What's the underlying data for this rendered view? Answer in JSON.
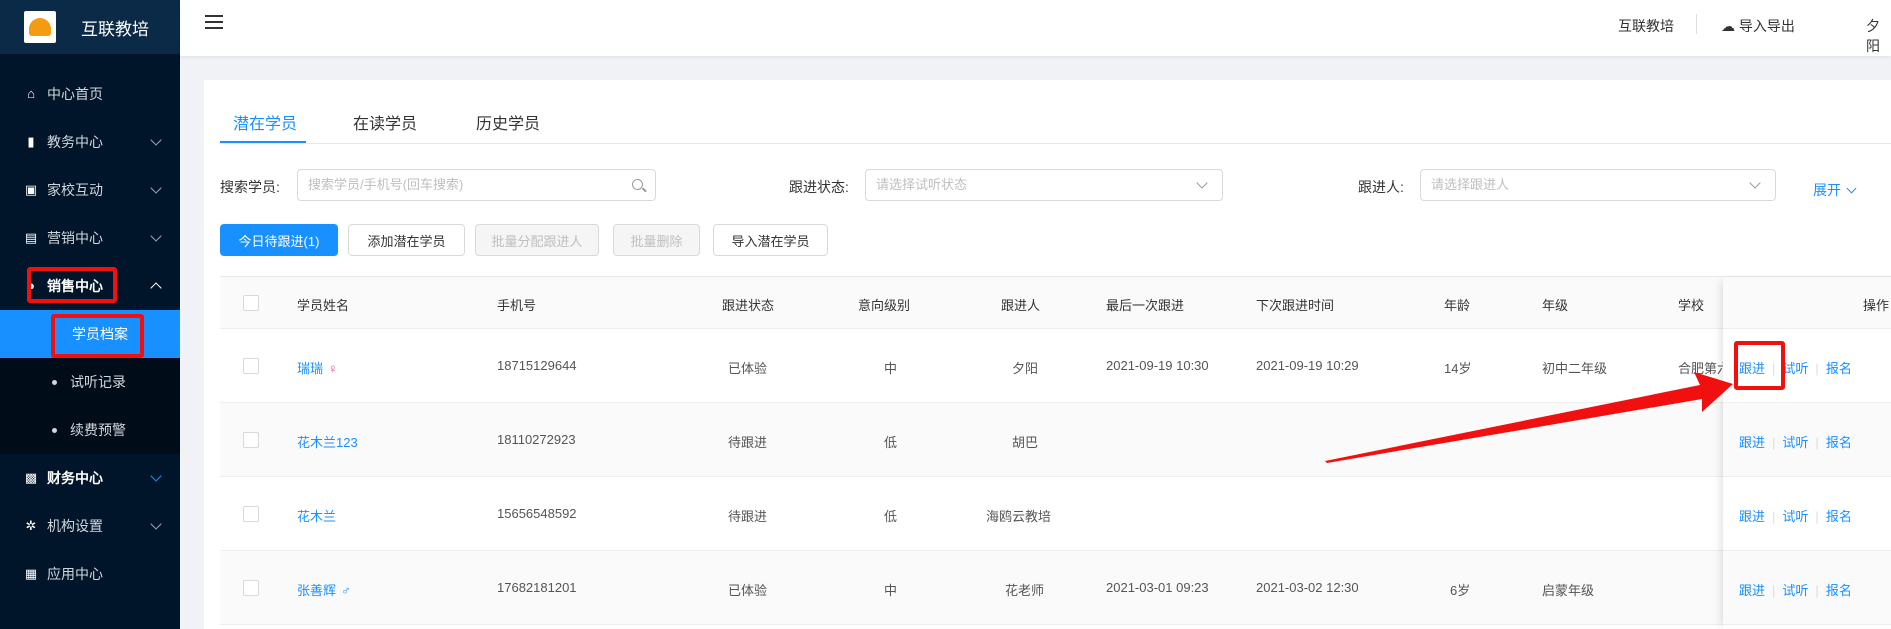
{
  "app": {
    "title": "互联教培",
    "colors": {
      "sidebar": "#001529",
      "accent": "#1890ff",
      "highlight": "#f01010"
    }
  },
  "sidebar": {
    "items": [
      {
        "label": "中心首页",
        "icon": "home-icon"
      },
      {
        "label": "教务中心",
        "icon": "book-icon"
      },
      {
        "label": "家校互动",
        "icon": "chat-icon"
      },
      {
        "label": "营销中心",
        "icon": "gift-icon"
      },
      {
        "label": "销售中心",
        "icon": "user-icon"
      },
      {
        "label": "财务中心",
        "icon": "wallet-icon"
      },
      {
        "label": "机构设置",
        "icon": "gear-icon"
      },
      {
        "label": "应用中心",
        "icon": "grid-icon"
      }
    ],
    "sales_sub": [
      "学员档案",
      "试听记录",
      "续费预警"
    ]
  },
  "topbar": {
    "org": "互联教培",
    "import_export": "导入导出",
    "user": "夕阳"
  },
  "tabs": [
    "潜在学员",
    "在读学员",
    "历史学员"
  ],
  "filters": {
    "search_label": "搜索学员:",
    "search_placeholder": "搜索学员/手机号(回车搜索)",
    "status_label": "跟进状态:",
    "status_placeholder": "请选择试听状态",
    "follower_label": "跟进人:",
    "follower_placeholder": "请选择跟进人",
    "expand": "展开"
  },
  "buttons": {
    "today": "今日待跟进(1)",
    "add": "添加潜在学员",
    "assign": "批量分配跟进人",
    "delete": "批量删除",
    "import": "导入潜在学员"
  },
  "table": {
    "headers": [
      "学员姓名",
      "手机号",
      "跟进状态",
      "意向级别",
      "跟进人",
      "最后一次跟进",
      "下次跟进时间",
      "年龄",
      "年级",
      "学校",
      "操作"
    ],
    "rows": [
      {
        "name": "瑞瑞",
        "gender": "♀",
        "phone": "18715129644",
        "status": "已体验",
        "level": "中",
        "follower": "夕阳",
        "last": "2021-09-19 10:30",
        "next": "2021-09-19 10:29",
        "age": "14岁",
        "grade": "初中二年级",
        "school": "合肥第六"
      },
      {
        "name": "花木兰123",
        "gender": "",
        "phone": "18110272923",
        "status": "待跟进",
        "level": "低",
        "follower": "胡巴",
        "last": "",
        "next": "",
        "age": "",
        "grade": "",
        "school": ""
      },
      {
        "name": "花木兰",
        "gender": "",
        "phone": "15656548592",
        "status": "待跟进",
        "level": "低",
        "follower": "海鸥云教培",
        "last": "",
        "next": "",
        "age": "",
        "grade": "",
        "school": ""
      },
      {
        "name": "张善辉",
        "gender": "♂",
        "phone": "17682181201",
        "status": "已体验",
        "level": "中",
        "follower": "花老师",
        "last": "2021-03-01 09:23",
        "next": "2021-03-02 12:30",
        "age": "6岁",
        "grade": "启蒙年级",
        "school": ""
      }
    ],
    "ops": [
      "跟进",
      "试听",
      "报名"
    ]
  }
}
